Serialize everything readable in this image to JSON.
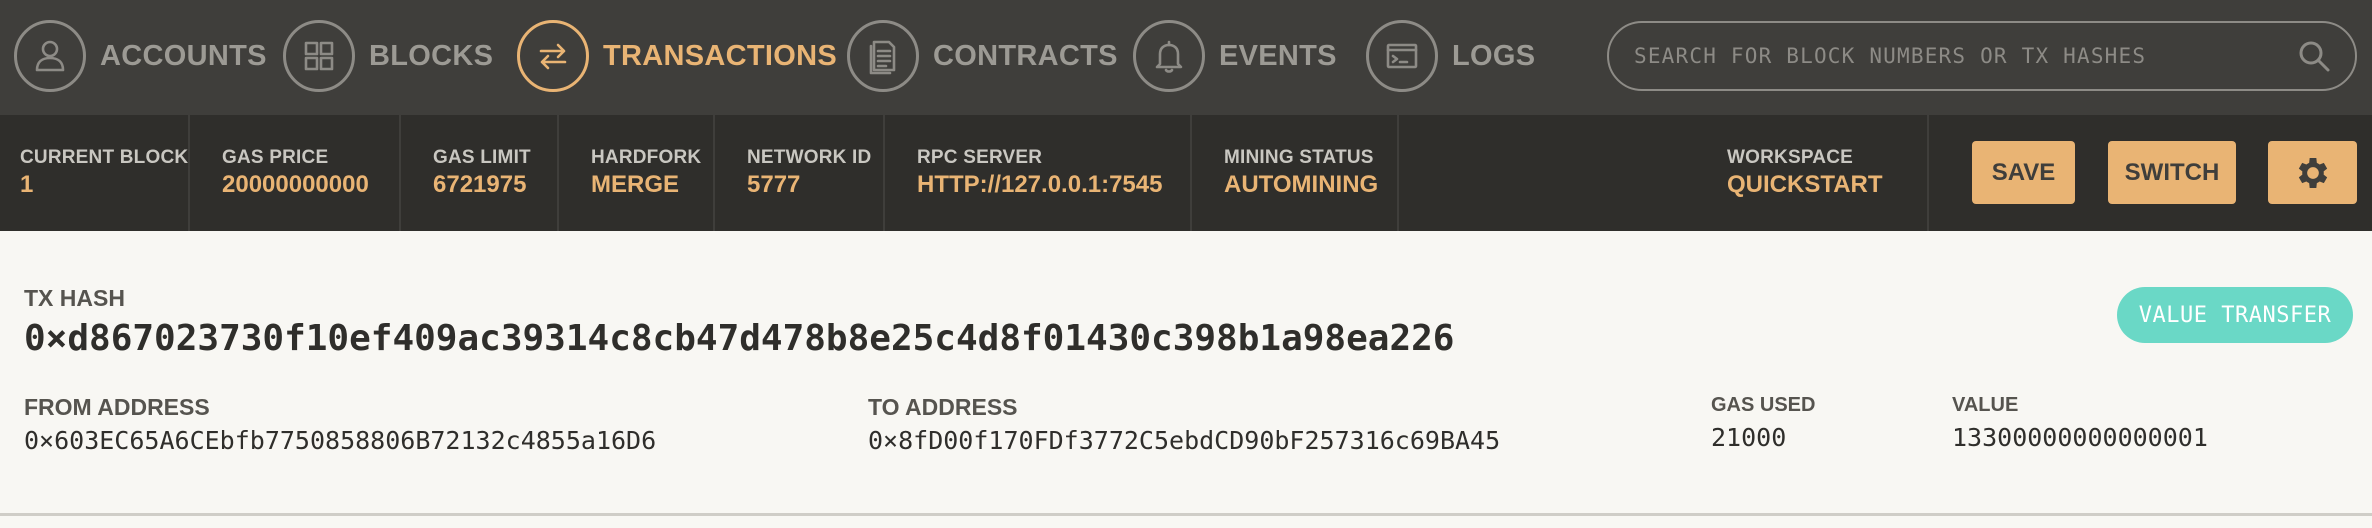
{
  "nav": {
    "items": [
      {
        "label": "ACCOUNTS",
        "icon": "user-icon"
      },
      {
        "label": "BLOCKS",
        "icon": "grid-icon"
      },
      {
        "label": "TRANSACTIONS",
        "icon": "swap-arrows-icon"
      },
      {
        "label": "CONTRACTS",
        "icon": "document-icon"
      },
      {
        "label": "EVENTS",
        "icon": "bell-icon"
      },
      {
        "label": "LOGS",
        "icon": "terminal-icon"
      }
    ],
    "active": "TRANSACTIONS",
    "search_placeholder": "SEARCH FOR BLOCK NUMBERS OR TX HASHES"
  },
  "status": {
    "current_block": {
      "label": "CURRENT BLOCK",
      "value": "1"
    },
    "gas_price": {
      "label": "GAS PRICE",
      "value": "20000000000"
    },
    "gas_limit": {
      "label": "GAS LIMIT",
      "value": "6721975"
    },
    "hardfork": {
      "label": "HARDFORK",
      "value": "MERGE"
    },
    "network_id": {
      "label": "NETWORK ID",
      "value": "5777"
    },
    "rpc_server": {
      "label": "RPC SERVER",
      "value": "HTTP://127.0.0.1:7545"
    },
    "mining_status": {
      "label": "MINING STATUS",
      "value": "AUTOMINING"
    },
    "workspace": {
      "label": "WORKSPACE",
      "value": "QUICKSTART"
    },
    "save_label": "SAVE",
    "switch_label": "SWITCH",
    "settings_icon": "gear-icon"
  },
  "tx": {
    "hash_label": "TX HASH",
    "hash": "0×d867023730f10ef409ac39314c8cb47d478b8e25c4d8f01430c398b1a98ea226",
    "type_badge": "VALUE TRANSFER",
    "from_label": "FROM ADDRESS",
    "from": "0×603EC65A6CEbfb7750858806B72132c4855a16D6",
    "to_label": "TO ADDRESS",
    "to": "0×8fD00f170FDf3772C5ebdCD90bF257316c69BA45",
    "gas_used_label": "GAS USED",
    "gas_used": "21000",
    "value_label": "VALUE",
    "value": "13300000000000001"
  },
  "colors": {
    "nav_bg": "#3f3e3b",
    "status_bg": "#2f2e2b",
    "accent": "#e9b474",
    "badge": "#6ad8c6",
    "content_bg": "#f8f7f3"
  }
}
